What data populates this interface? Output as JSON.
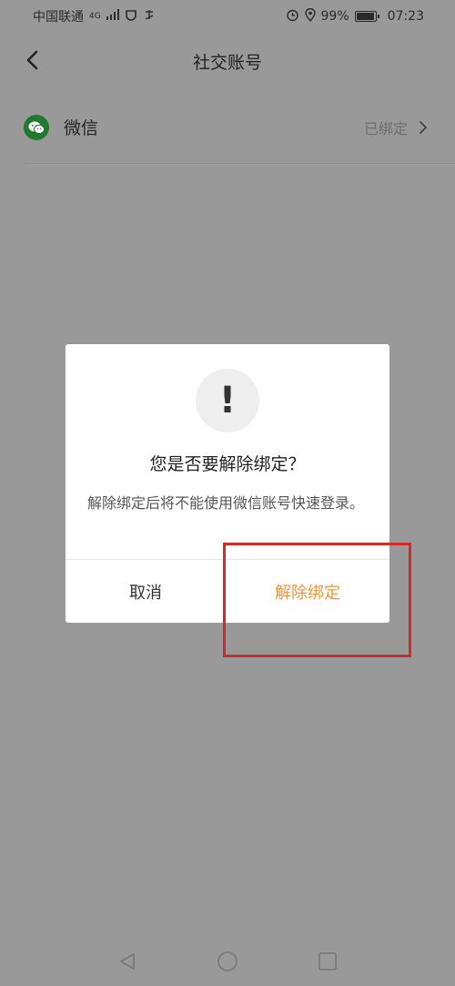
{
  "status_bar": {
    "carrier": "中国联通",
    "network": "4G",
    "battery_percent": "99%",
    "time": "07:23"
  },
  "header": {
    "title": "社交账号"
  },
  "account_row": {
    "label": "微信",
    "status": "已绑定"
  },
  "dialog": {
    "title": "您是否要解除绑定？",
    "message": "解除绑定后将不能使用微信账号快速登录。",
    "cancel_label": "取消",
    "confirm_label": "解除绑定",
    "icon_glyph": "!"
  },
  "colors": {
    "overlay": "#999999",
    "accent": "#f0953a",
    "wechat": "#1f7a2d",
    "highlight": "#d32a2a"
  }
}
